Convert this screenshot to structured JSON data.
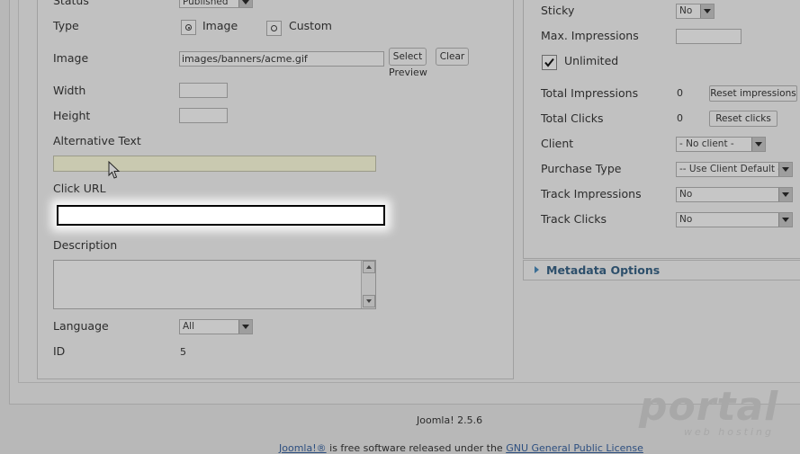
{
  "left": {
    "status": {
      "label": "Status",
      "value": "Published"
    },
    "type": {
      "label": "Type",
      "options": [
        {
          "label": "Image",
          "selected": true
        },
        {
          "label": "Custom",
          "selected": false
        }
      ]
    },
    "image": {
      "label": "Image",
      "value": "images/banners/acme.gif",
      "select_label": "Select",
      "clear_label": "Clear",
      "preview_label": "Preview"
    },
    "width": {
      "label": "Width",
      "value": ""
    },
    "height": {
      "label": "Height",
      "value": ""
    },
    "alt_text": {
      "label": "Alternative Text",
      "value": ""
    },
    "click_url": {
      "label": "Click URL",
      "value": ""
    },
    "description": {
      "label": "Description",
      "value": ""
    },
    "language": {
      "label": "Language",
      "value": "All"
    },
    "id": {
      "label": "ID",
      "value": "5"
    }
  },
  "right": {
    "sticky": {
      "label": "Sticky",
      "value": "No"
    },
    "max_impressions": {
      "label": "Max. Impressions",
      "value": ""
    },
    "unlimited": {
      "label": "Unlimited",
      "checked": true
    },
    "total_impressions": {
      "label": "Total Impressions",
      "value": "0",
      "button": "Reset impressions"
    },
    "total_clicks": {
      "label": "Total Clicks",
      "value": "0",
      "button": "Reset clicks"
    },
    "client": {
      "label": "Client",
      "value": "- No client -"
    },
    "purchase_type": {
      "label": "Purchase Type",
      "value": "-- Use Client Default --"
    },
    "track_impressions": {
      "label": "Track Impressions",
      "value": "No"
    },
    "track_clicks": {
      "label": "Track Clicks",
      "value": "No"
    }
  },
  "metadata": {
    "title": "Metadata Options"
  },
  "footer": {
    "version": "Joomla! 2.5.6",
    "license_prefix": "Joomla!®",
    "license_middle": " is free software released under the ",
    "license_link": "GNU General Public License"
  },
  "watermark": {
    "logo": "portal",
    "sub": "web hosting"
  }
}
